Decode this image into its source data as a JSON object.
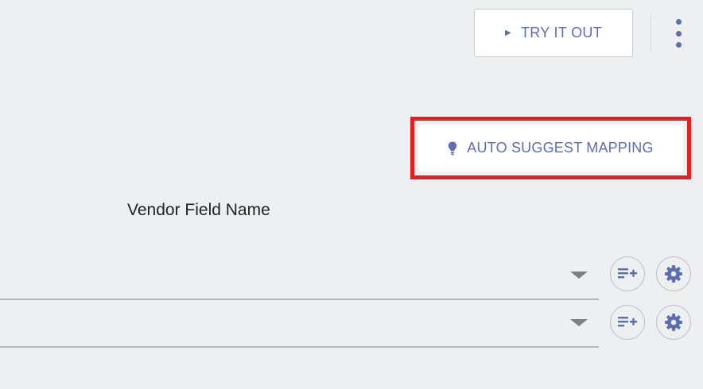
{
  "toolbar": {
    "try_label": "TRY IT OUT",
    "more_icon": "kebab-vertical-icon"
  },
  "mapping": {
    "auto_suggest_label": "AUTO SUGGEST MAPPING",
    "column_header": "Vendor Field Name",
    "rows": [
      {
        "value": ""
      },
      {
        "value": ""
      }
    ]
  },
  "colors": {
    "accent": "#5a6fb0",
    "highlight": "#e3201e",
    "background": "#eeeff1"
  }
}
